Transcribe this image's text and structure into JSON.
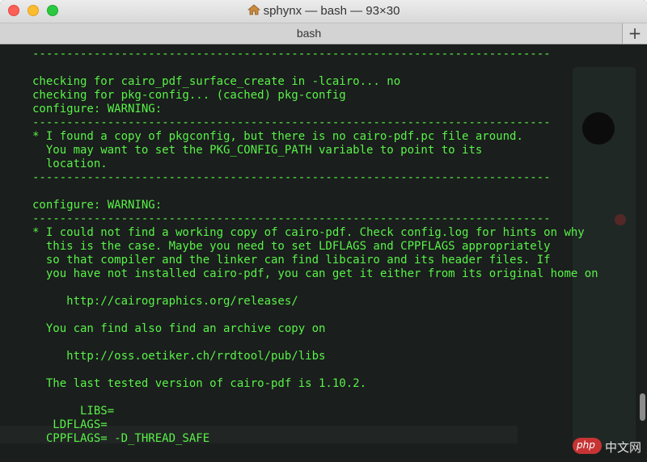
{
  "window": {
    "title": "sphynx — bash — 93×30",
    "tab_label": "bash",
    "new_tab_symbol": "+",
    "home_icon": "home-icon"
  },
  "terminal": {
    "text_color": "#59f249",
    "background": "#1a1e1c",
    "lines": [
      "----------------------------------------------------------------------------",
      "",
      "checking for cairo_pdf_surface_create in -lcairo... no",
      "checking for pkg-config... (cached) pkg-config",
      "configure: WARNING:",
      "----------------------------------------------------------------------------",
      "* I found a copy of pkgconfig, but there is no cairo-pdf.pc file around.",
      "  You may want to set the PKG_CONFIG_PATH variable to point to its",
      "  location.",
      "----------------------------------------------------------------------------",
      "",
      "configure: WARNING:",
      "----------------------------------------------------------------------------",
      "* I could not find a working copy of cairo-pdf. Check config.log for hints on why",
      "  this is the case. Maybe you need to set LDFLAGS and CPPFLAGS appropriately",
      "  so that compiler and the linker can find libcairo and its header files. If",
      "  you have not installed cairo-pdf, you can get it either from its original home on",
      "",
      "     http://cairographics.org/releases/",
      "",
      "  You can find also find an archive copy on",
      "",
      "     http://oss.oetiker.ch/rrdtool/pub/libs",
      "",
      "  The last tested version of cairo-pdf is 1.10.2.",
      "",
      "       LIBS=",
      "   LDFLAGS=",
      "  CPPFLAGS= -D_THREAD_SAFE"
    ]
  },
  "watermark": {
    "logo_text": "php",
    "site_text": "中文网"
  }
}
